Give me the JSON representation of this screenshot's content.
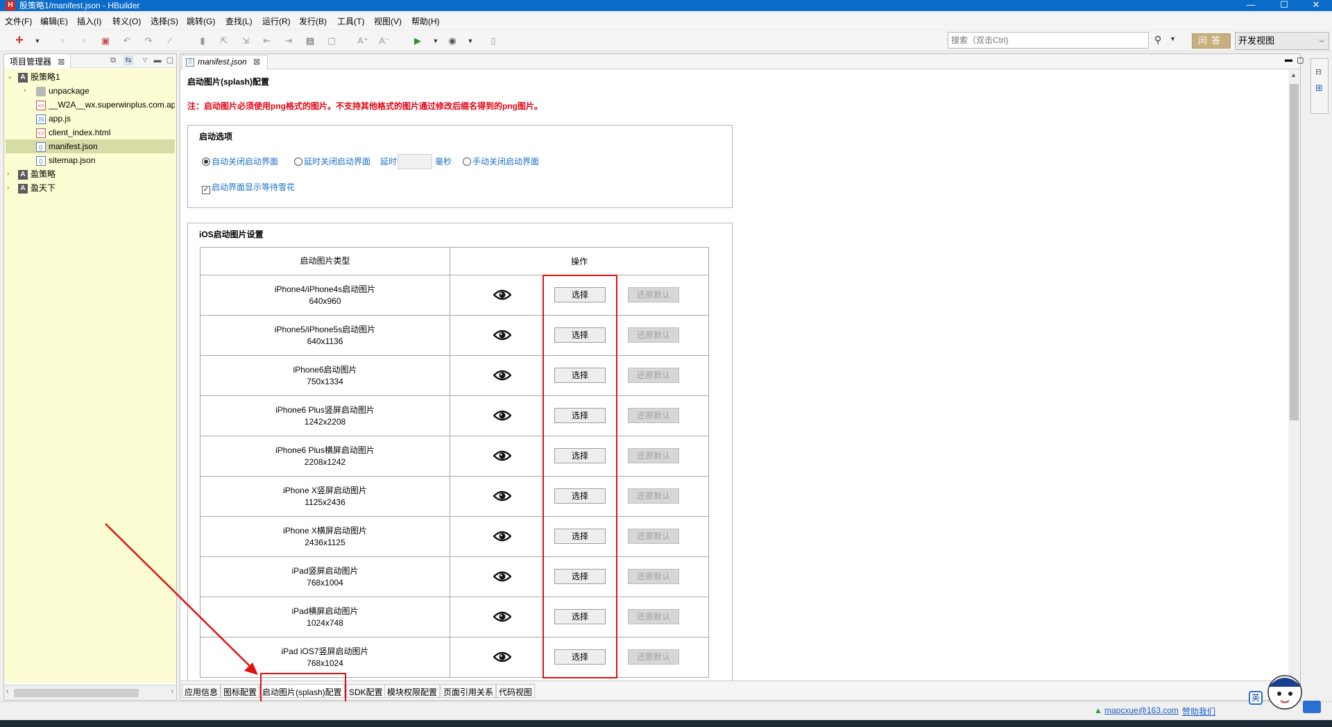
{
  "window": {
    "title": "股策略1/manifest.json - HBuilder",
    "logo_letter": "H",
    "minimize": "—",
    "maximize": "☐",
    "close": "✕"
  },
  "menu": [
    "文件(F)",
    "编辑(E)",
    "插入(I)",
    "转义(O)",
    "选择(S)",
    "跳转(G)",
    "查找(L)",
    "运行(R)",
    "发行(B)",
    "工具(T)",
    "视图(V)",
    "帮助(H)"
  ],
  "toolbar": {
    "search_placeholder": "搜索（双击Ctrl)",
    "search_icon": "search-icon",
    "ask_label": "问答",
    "perspective": "开发视图"
  },
  "project_panel": {
    "tab_label": "项目管理器",
    "tree": [
      {
        "label": "股策略1",
        "icon": "project-icon"
      },
      {
        "label": "unpackage",
        "icon": "folder-icon"
      },
      {
        "label": "__W2A__wx.superwinplus.com.ap",
        "icon": "html-file-icon"
      },
      {
        "label": "app.js",
        "icon": "js-file-icon"
      },
      {
        "label": "client_index.html",
        "icon": "html-file-icon"
      },
      {
        "label": "manifest.json",
        "icon": "json-file-icon",
        "selected": true
      },
      {
        "label": "sitemap.json",
        "icon": "json-file-icon"
      },
      {
        "label": "盈策略",
        "icon": "project-icon"
      },
      {
        "label": "盈天下",
        "icon": "project-icon"
      }
    ]
  },
  "editor": {
    "tab_label": "manifest.json",
    "page_title": "启动图片(splash)配置",
    "warning": "注：启动图片必须使用png格式的图片。不支持其他格式的图片通过修改后缀名得到的png图片。",
    "startup_options": {
      "legend": "启动选项",
      "auto_close": "自动关闭启动界面",
      "delay_close": "延时关闭启动界面",
      "delay_label": "延时",
      "ms_label": "毫秒",
      "manual_close": "手动关闭启动界面",
      "wait_snow": "启动界面显示等待雪花"
    },
    "ios": {
      "legend": "iOS启动图片设置",
      "col_type": "启动图片类型",
      "col_action": "操作",
      "choose_label": "选择",
      "restore_label": "还原默认",
      "rows": [
        {
          "name": "iPhone4/iPhone4s启动图片",
          "size": "640x960"
        },
        {
          "name": "iPhone5/iPhone5s启动图片",
          "size": "640x1136"
        },
        {
          "name": "iPhone6启动图片",
          "size": "750x1334"
        },
        {
          "name": "iPhone6 Plus竖屏启动图片",
          "size": "1242x2208"
        },
        {
          "name": "iPhone6 Plus横屏启动图片",
          "size": "2208x1242"
        },
        {
          "name": "iPhone X竖屏启动图片",
          "size": "1125x2436"
        },
        {
          "name": "iPhone X横屏启动图片",
          "size": "2436x1125"
        },
        {
          "name": "iPad竖屏启动图片",
          "size": "768x1004"
        },
        {
          "name": "iPad横屏启动图片",
          "size": "1024x748"
        },
        {
          "name": "iPad iOS7竖屏启动图片",
          "size": "768x1024"
        }
      ]
    },
    "bottom_tabs": [
      "应用信息",
      "图标配置",
      "启动图片(splash)配置",
      "SDK配置",
      "模块权限配置",
      "页面引用关系",
      "代码视图"
    ],
    "active_bottom_tab": "启动图片(splash)配置"
  },
  "status": {
    "email": "mapcxue@163.com",
    "help": "赞助我们",
    "mascot_label": "英"
  },
  "colors": {
    "titlebar": "#0b6bc9",
    "warning": "#e60012",
    "highlight": "#e01010",
    "tree_bg": "#fdfdd3"
  }
}
